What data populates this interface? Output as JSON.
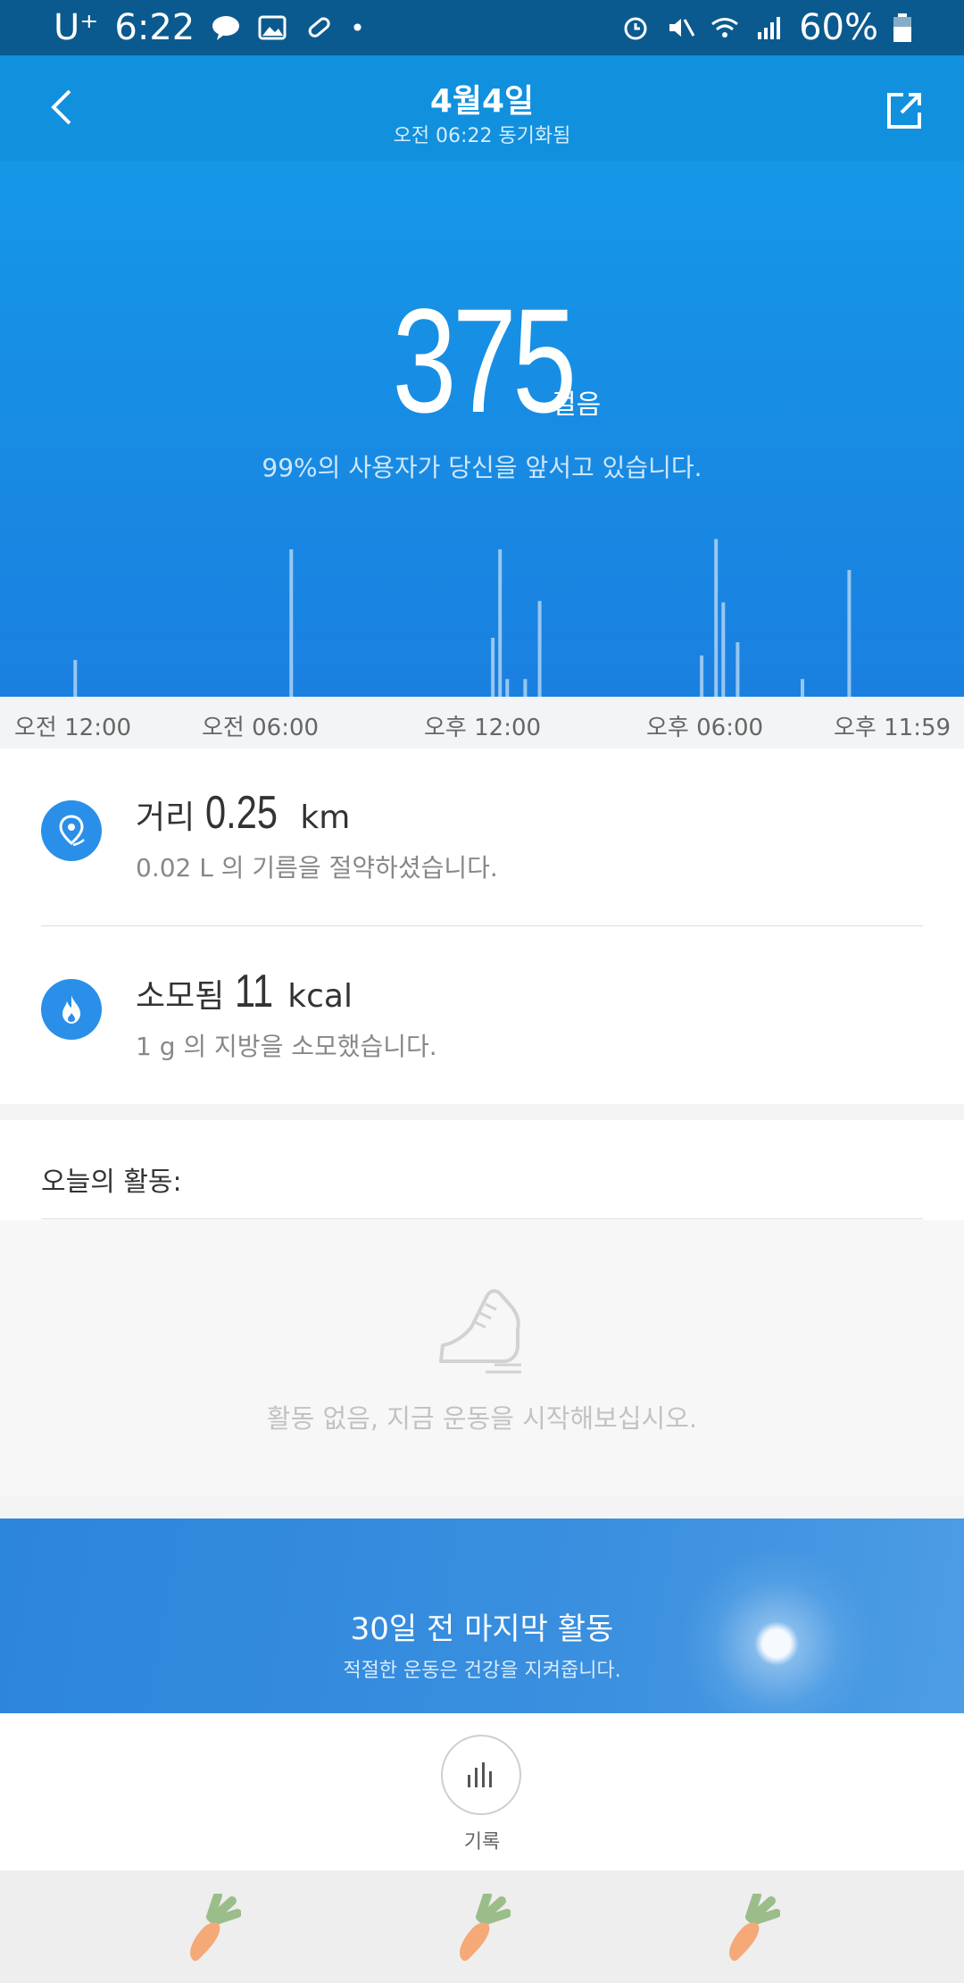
{
  "status_bar": {
    "carrier": "U⁺",
    "time": "6:22",
    "battery": "60%"
  },
  "header": {
    "title": "4월4일",
    "subtitle": "오전 06:22 동기화됨"
  },
  "hero": {
    "steps": "375",
    "steps_unit": "걸음",
    "rank_text": "99%의 사용자가 당신을 앞서고 있습니다."
  },
  "chart_data": {
    "type": "bar",
    "x_labels": [
      "오전 12:00",
      "오전 06:00",
      "오후 12:00",
      "오후 06:00",
      "오후 11:59"
    ],
    "bars": [
      {
        "hour": 0.8,
        "value": 25
      },
      {
        "hour": 6.8,
        "value": 100
      },
      {
        "hour": 12.4,
        "value": 40
      },
      {
        "hour": 12.6,
        "value": 100
      },
      {
        "hour": 12.8,
        "value": 12
      },
      {
        "hour": 13.3,
        "value": 12
      },
      {
        "hour": 13.7,
        "value": 65
      },
      {
        "hour": 18.2,
        "value": 28
      },
      {
        "hour": 18.6,
        "value": 107
      },
      {
        "hour": 18.8,
        "value": 64
      },
      {
        "hour": 19.2,
        "value": 37
      },
      {
        "hour": 21.0,
        "value": 12
      },
      {
        "hour": 22.3,
        "value": 86
      }
    ]
  },
  "distance": {
    "label": "거리",
    "value": "0.25",
    "unit": "km",
    "sub": "0.02 L 의 기름을 절약하셨습니다."
  },
  "calories": {
    "label": "소모됨",
    "value": "11",
    "unit": "kcal",
    "sub": "1 g 의 지방을 소모했습니다."
  },
  "activity": {
    "title": "오늘의 활동:",
    "empty_text": "활동 없음, 지금 운동을 시작해보십시오."
  },
  "banner": {
    "title": "30일 전 마지막 활동",
    "subtitle": "적절한 운동은 건강을 지켜줍니다."
  },
  "record": {
    "label": "기록"
  },
  "colors": {
    "header": "#1190de",
    "accent": "#2a8fe8"
  }
}
